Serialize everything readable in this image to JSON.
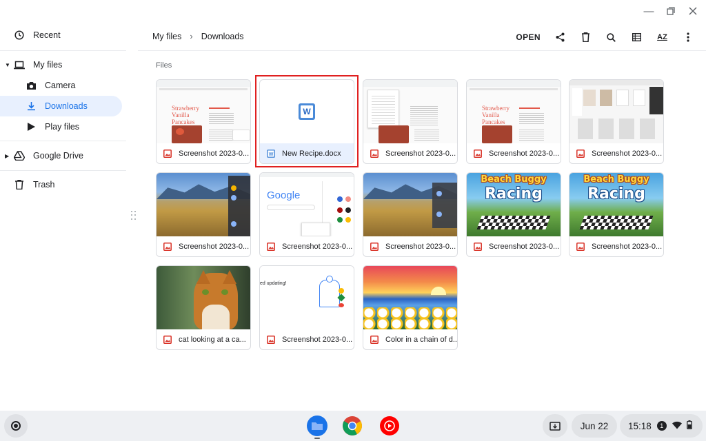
{
  "window": {
    "controls": [
      "minimize",
      "restore",
      "close"
    ]
  },
  "sidebar": {
    "items": [
      {
        "label": "Recent",
        "icon": "clock-icon"
      },
      {
        "label": "My files",
        "icon": "laptop-icon"
      },
      {
        "label": "Camera",
        "icon": "camera-icon"
      },
      {
        "label": "Downloads",
        "icon": "download-icon",
        "active": true
      },
      {
        "label": "Play files",
        "icon": "play-icon"
      },
      {
        "label": "Google Drive",
        "icon": "drive-icon"
      },
      {
        "label": "Trash",
        "icon": "trash-icon"
      }
    ]
  },
  "breadcrumb": {
    "root": "My files",
    "current": "Downloads"
  },
  "toolbar": {
    "open_label": "OPEN",
    "sort_label": "AZ"
  },
  "section": {
    "title": "Files"
  },
  "files": [
    {
      "name": "Screenshot 2023-0...",
      "type": "image"
    },
    {
      "name": "New Recipe.docx",
      "type": "docx",
      "selected": true
    },
    {
      "name": "Screenshot 2023-0...",
      "type": "image"
    },
    {
      "name": "Screenshot 2023-0...",
      "type": "image"
    },
    {
      "name": "Screenshot 2023-0...",
      "type": "image"
    },
    {
      "name": "Screenshot 2023-0...",
      "type": "image"
    },
    {
      "name": "Screenshot 2023-0...",
      "type": "image"
    },
    {
      "name": "Screenshot 2023-0...",
      "type": "image"
    },
    {
      "name": "Screenshot 2023-0...",
      "type": "image"
    },
    {
      "name": "Screenshot 2023-0...",
      "type": "image"
    },
    {
      "name": "cat looking at a ca...",
      "type": "image"
    },
    {
      "name": "Screenshot 2023-0...",
      "type": "image"
    },
    {
      "name": "Color in a chain of d...",
      "type": "image"
    }
  ],
  "thumb_text": {
    "recipe_title_1": "Strawberry",
    "recipe_title_2": "Vanilla",
    "recipe_title_3": "Pancakes",
    "google_logo": "Google",
    "bbr_line1": "Beach Buggy",
    "bbr_line2": "Racing",
    "updating": "ed updating!",
    "docx_badge": "W"
  },
  "shelf": {
    "date": "Jun 22",
    "time": "15:18",
    "notification_count": "1"
  },
  "colors": {
    "accent": "#1a73e8",
    "active_bg": "#e8f0fe",
    "highlight": "#e02020",
    "image_icon": "#d93025"
  }
}
